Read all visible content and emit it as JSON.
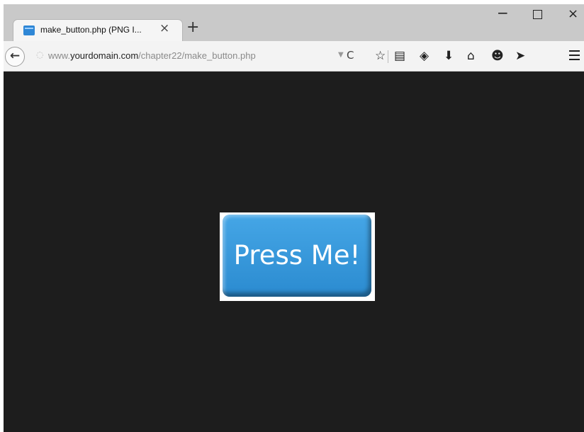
{
  "tab": {
    "title": "make_button.php (PNG I...",
    "close": "×"
  },
  "newtab": "+",
  "window_controls": {
    "minimize": "−",
    "close": "×"
  },
  "address": {
    "prefix": "www.",
    "host": "yourdomain.com",
    "path": "/chapter22/make_button.php"
  },
  "toolbar": {
    "back": "←",
    "reload": "C",
    "icons": [
      "bookmark-star-icon",
      "reading-list-icon",
      "pocket-icon",
      "download-icon",
      "home-icon",
      "chat-icon",
      "send-icon",
      "menu-icon"
    ]
  },
  "content": {
    "button_text": "Press Me!",
    "button_color": "#3a9be0",
    "background": "#1d1d1d"
  }
}
